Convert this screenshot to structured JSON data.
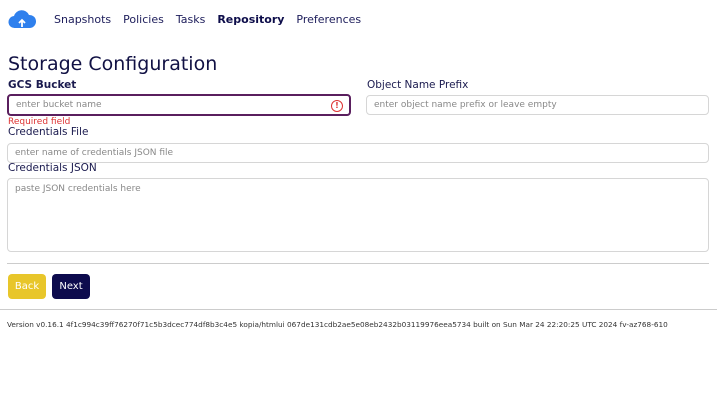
{
  "nav": {
    "items": [
      {
        "label": "Snapshots"
      },
      {
        "label": "Policies"
      },
      {
        "label": "Tasks"
      },
      {
        "label": "Repository",
        "active": true
      },
      {
        "label": "Preferences"
      }
    ]
  },
  "page": {
    "title": "Storage Configuration"
  },
  "form": {
    "bucket": {
      "label": "GCS Bucket",
      "placeholder": "enter bucket name",
      "error": "Required field"
    },
    "prefix": {
      "label": "Object Name Prefix",
      "placeholder": "enter object name prefix or leave empty"
    },
    "credfile": {
      "label": "Credentials File",
      "placeholder": "enter name of credentials JSON file"
    },
    "credjson": {
      "label": "Credentials JSON",
      "placeholder": "paste JSON credentials here"
    }
  },
  "buttons": {
    "back": "Back",
    "next": "Next"
  },
  "colors": {
    "back": "#e8c62a",
    "next": "#0d0b4d",
    "error": "#dd3333"
  },
  "footer": {
    "version": "Version v0.16.1 4f1c994c39ff76270f71c5b3dcec774df8b3c4e5 kopia/htmlui 067de131cdb2ae5e08eb2432b03119976eea5734 built on Sun Mar 24 22:20:25 UTC 2024 fv-az768-610"
  }
}
